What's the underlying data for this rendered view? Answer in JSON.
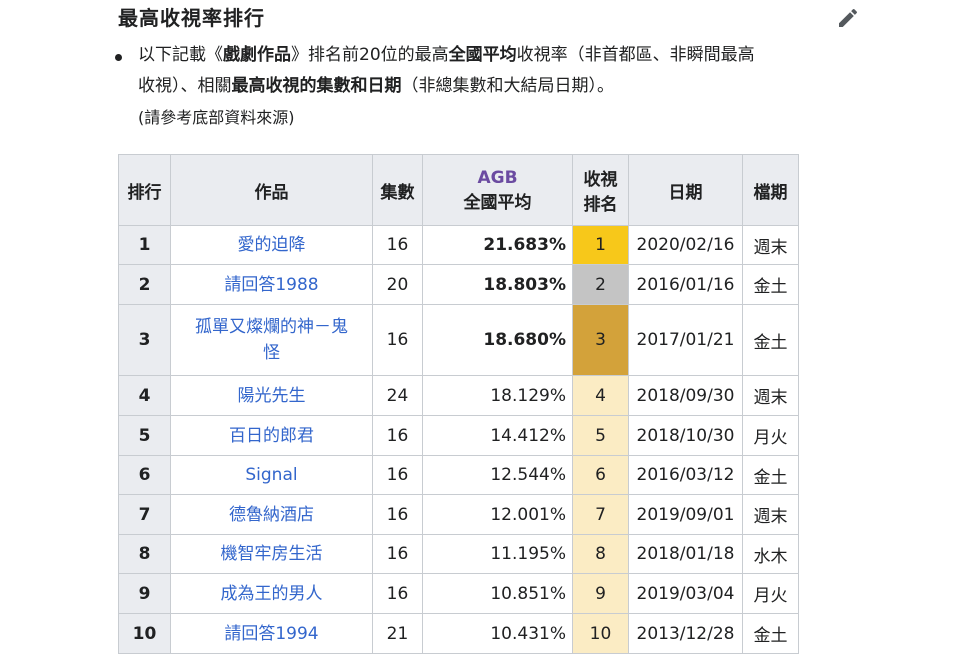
{
  "section": {
    "heading": "最高收視率排行"
  },
  "note": {
    "p1": "以下記載《",
    "p2": "戲劇作品",
    "p3": "》排名前20位的最高",
    "p4": "全國平均",
    "p5": "收視率（非首都區、非瞬間最高",
    "p6": "收視）、相關",
    "p7": "最高收視的集數和日期",
    "p8": "（非總集數和大結局日期）。",
    "p9": "(請參考底部資料來源)"
  },
  "table": {
    "headers": {
      "rank": "排行",
      "title": "作品",
      "episode": "集數",
      "agb": "AGB",
      "agb_sub": "全國平均",
      "vr_line1": "收視",
      "vr_line2": "排名",
      "date": "日期",
      "slot": "檔期"
    },
    "rows": [
      {
        "rank": "1",
        "title": "愛的迫降",
        "episode": "16",
        "rating": "21.683%",
        "vrank": "1",
        "date": "2020/02/16",
        "slot": "週末"
      },
      {
        "rank": "2",
        "title": "請回答1988",
        "episode": "20",
        "rating": "18.803%",
        "vrank": "2",
        "date": "2016/01/16",
        "slot": "金土"
      },
      {
        "rank": "3",
        "title": "孤單又燦爛的神－鬼怪",
        "title_l1": "孤單又燦爛的神－鬼",
        "title_l2": "怪",
        "episode": "16",
        "rating": "18.680%",
        "vrank": "3",
        "date": "2017/01/21",
        "slot": "金土"
      },
      {
        "rank": "4",
        "title": "陽光先生",
        "episode": "24",
        "rating": "18.129%",
        "vrank": "4",
        "date": "2018/09/30",
        "slot": "週末"
      },
      {
        "rank": "5",
        "title": "百日的郎君",
        "episode": "16",
        "rating": "14.412%",
        "vrank": "5",
        "date": "2018/10/30",
        "slot": "月火"
      },
      {
        "rank": "6",
        "title": "Signal",
        "episode": "16",
        "rating": "12.544%",
        "vrank": "6",
        "date": "2016/03/12",
        "slot": "金土"
      },
      {
        "rank": "7",
        "title": "德魯納酒店",
        "episode": "16",
        "rating": "12.001%",
        "vrank": "7",
        "date": "2019/09/01",
        "slot": "週末"
      },
      {
        "rank": "8",
        "title": "機智牢房生活",
        "episode": "16",
        "rating": "11.195%",
        "vrank": "8",
        "date": "2018/01/18",
        "slot": "水木"
      },
      {
        "rank": "9",
        "title": "成為王的男人",
        "episode": "16",
        "rating": "10.851%",
        "vrank": "9",
        "date": "2019/03/04",
        "slot": "月火"
      },
      {
        "rank": "10",
        "title": "請回答1994",
        "episode": "21",
        "rating": "10.431%",
        "vrank": "10",
        "date": "2013/12/28",
        "slot": "金土"
      }
    ]
  },
  "colors": {
    "gold": "#f7c81a",
    "silver": "#c4c4c4",
    "bronze": "#d3a23a",
    "pale": "#fbecc4",
    "link": "#3366cc",
    "agb": "#6b4ba1"
  },
  "icons": {
    "edit": "pencil-icon"
  }
}
